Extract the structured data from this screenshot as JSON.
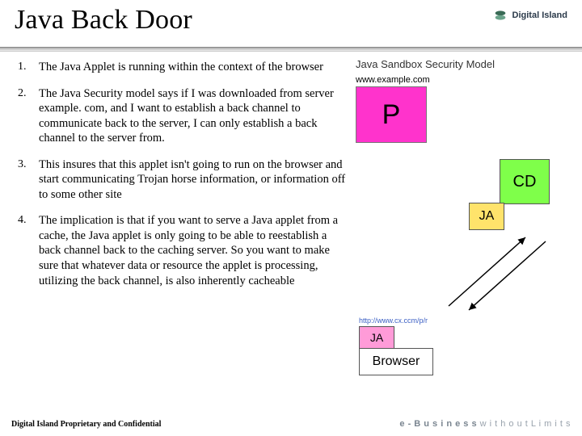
{
  "header": {
    "title": "Java Back Door",
    "brand": "Digital Island"
  },
  "points": [
    {
      "n": "1.",
      "text": "The Java Applet is running within the context of the browser"
    },
    {
      "n": "2.",
      "text": "The Java Security model says if I was downloaded from server example. com, and I want to establish a back channel to communicate back to the server, I can only establish a back channel to the server from."
    },
    {
      "n": "3.",
      "text": "This insures that this applet isn't going to run on the browser and start communicating Trojan horse information, or information off to some other site"
    },
    {
      "n": "4.",
      "text": "The implication is that if you want to serve a Java applet from a cache, the Java applet is only going to be able to reestablish a back channel back to the caching server.  So you want to make sure that whatever data or resource the applet is processing, utilizing the back channel, is also inherently cacheable"
    }
  ],
  "diagram": {
    "title": "Java Sandbox Security Model",
    "url1": "www.example.com",
    "p_label": "P",
    "cd_label": "CD",
    "ja_label": "JA",
    "url2": "http://www.cx.ccm/p/r",
    "ja2_label": "JA",
    "browser_label": "Browser"
  },
  "footer": {
    "left": "Digital Island Proprietary and Confidential",
    "right_prefix": "e - B u s i n e s s",
    "right_suffix": "  w i t h o u t   L i m i t s"
  }
}
